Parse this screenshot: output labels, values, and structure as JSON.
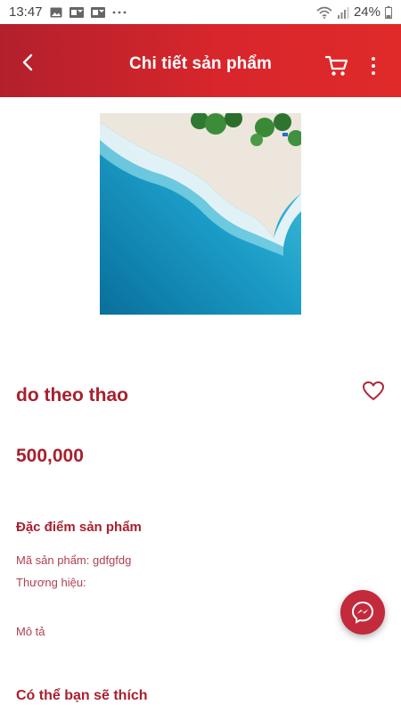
{
  "status_bar": {
    "time": "13:47",
    "battery": "24%"
  },
  "header": {
    "title": "Chi tiết sản phẩm"
  },
  "product": {
    "name": "do theo thao",
    "price": "500,000"
  },
  "details": {
    "section_title": "Đặc điểm sản phẩm",
    "code_line": "Mã sản phẩm: gdfgfdg",
    "brand_line": "Thương hiệu:",
    "description_line": "Mô tả"
  },
  "suggestions": {
    "title": "Có thể bạn sẽ thích"
  },
  "icons": {
    "back": "arrow-left-icon",
    "cart": "shopping-cart-icon",
    "more": "more-vertical-icon",
    "favorite": "heart-outline-icon",
    "messenger": "messenger-icon"
  },
  "colors": {
    "primary": "#d8262c",
    "text_accent": "#a8202e",
    "fab": "#c32a3c"
  }
}
